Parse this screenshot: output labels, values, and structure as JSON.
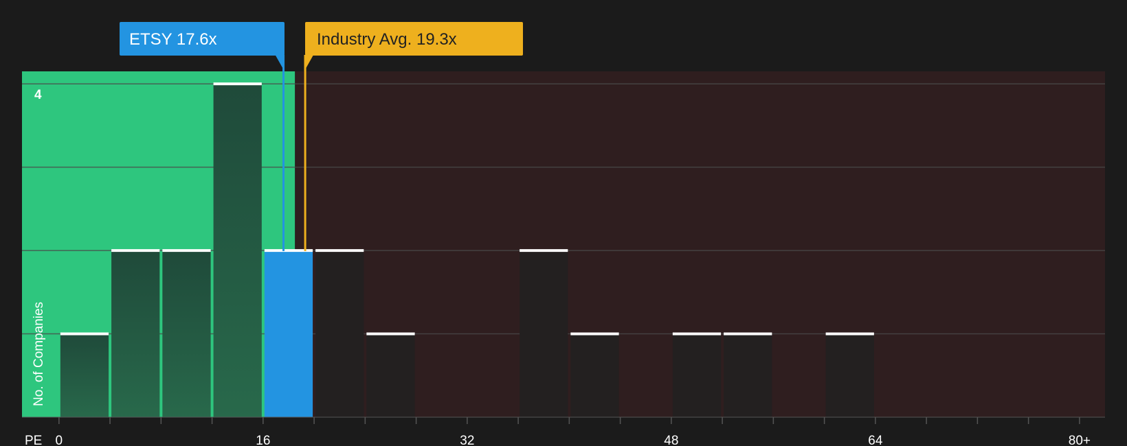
{
  "chart_data": {
    "type": "bar",
    "x_axis_label": "PE",
    "y_axis_label": "No. of Companies",
    "y_top_tick_label": "4",
    "x_ticks": [
      {
        "value": 0,
        "label": "0"
      },
      {
        "value": 16,
        "label": "16"
      },
      {
        "value": 32,
        "label": "32"
      },
      {
        "value": 48,
        "label": "48"
      },
      {
        "value": 64,
        "label": "64"
      },
      {
        "value": 80,
        "label": "80+"
      }
    ],
    "x_minor_ticks": [
      0,
      4,
      8,
      12,
      16,
      20,
      24,
      28,
      32,
      36,
      40,
      44,
      48,
      52,
      56,
      60,
      64,
      68,
      72,
      76,
      80
    ],
    "xlim": [
      -2.9,
      82
    ],
    "ylim": [
      0,
      4.15
    ],
    "y_gridlines": [
      1,
      2,
      3,
      4
    ],
    "bins": [
      {
        "start": 0,
        "end": 4,
        "count": 1
      },
      {
        "start": 4,
        "end": 8,
        "count": 2
      },
      {
        "start": 8,
        "end": 12,
        "count": 2
      },
      {
        "start": 12,
        "end": 16,
        "count": 4
      },
      {
        "start": 16,
        "end": 20,
        "count": 2,
        "highlight": true
      },
      {
        "start": 20,
        "end": 24,
        "count": 2
      },
      {
        "start": 24,
        "end": 28,
        "count": 1
      },
      {
        "start": 36,
        "end": 40,
        "count": 2
      },
      {
        "start": 40,
        "end": 44,
        "count": 1
      },
      {
        "start": 48,
        "end": 52,
        "count": 1
      },
      {
        "start": 52,
        "end": 56,
        "count": 1
      },
      {
        "start": 60,
        "end": 64,
        "count": 1
      }
    ],
    "undervalued_region_end": 18.5,
    "markers": [
      {
        "name": "ETSY",
        "label": "ETSY 17.6x",
        "value": 17.6,
        "color": "#2394e1"
      },
      {
        "name": "Industry Avg.",
        "label": "Industry Avg. 19.3x",
        "value": 19.3,
        "color": "#eeb01e"
      }
    ],
    "colors": {
      "background": "#1b1b1b",
      "undervalued_region": "#2ec67e",
      "overvalued_region": "#2f1e1f",
      "bar_in_green": "#1f4a3a",
      "bar_in_red": "#232020",
      "bar_highlight": "#2394e1",
      "bar_cap": "#ffffff",
      "gridline": "#4a4a4a"
    }
  }
}
